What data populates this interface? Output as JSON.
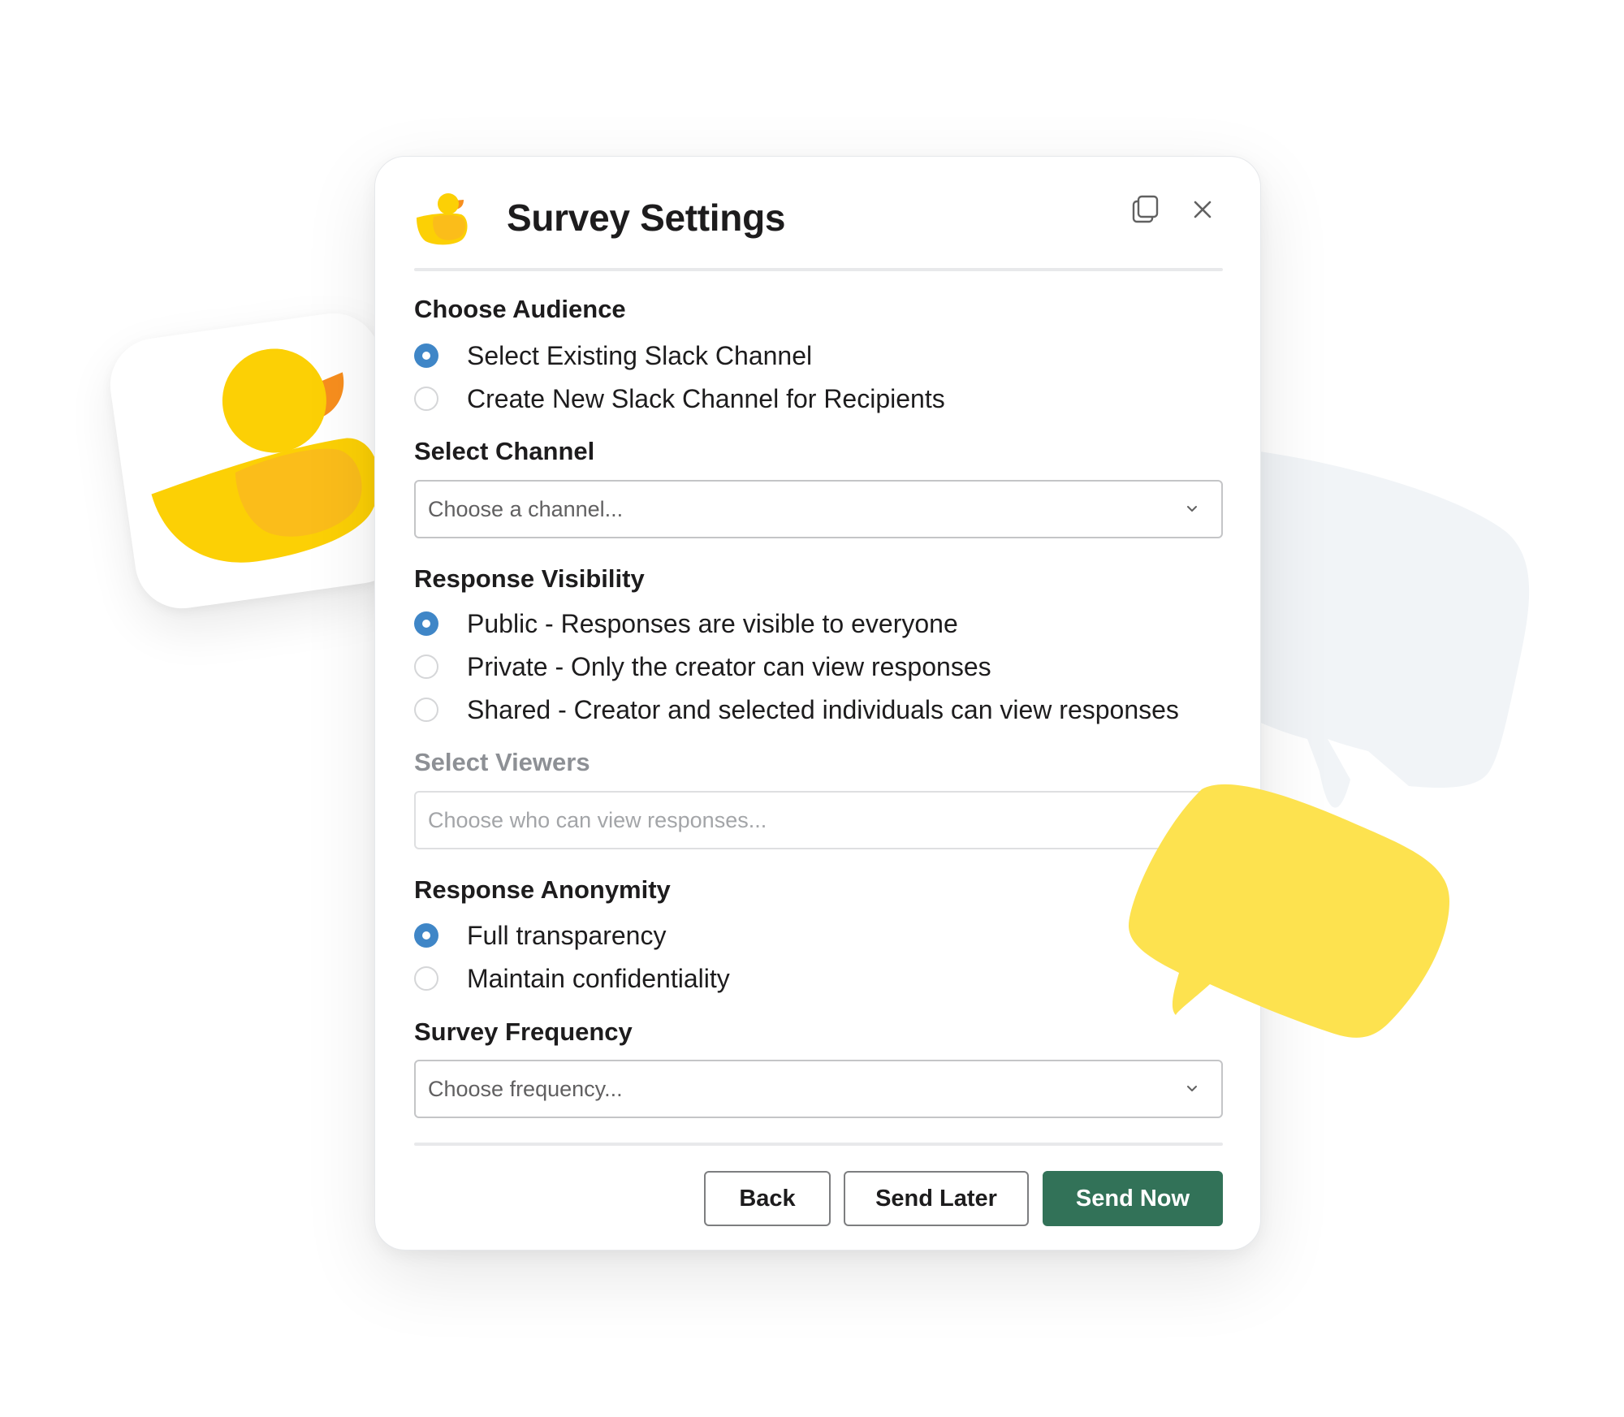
{
  "colors": {
    "primary_button": "#327258",
    "radio_selected": "#3f86c7",
    "duck_yellow": "#fcd005",
    "duck_beak": "#f78e1e",
    "bubble_yellow": "#fde24f",
    "bubble_gray": "#f1f4f7"
  },
  "icons": {
    "app_logo": "duck-icon",
    "window": "copy-icon",
    "close": "close-icon",
    "select_chevron": "chevron-down-icon"
  },
  "modal": {
    "title": "Survey Settings",
    "audience": {
      "label": "Choose Audience",
      "options": [
        {
          "label": "Select Existing Slack Channel",
          "selected": true
        },
        {
          "label": "Create New Slack Channel for Recipients",
          "selected": false
        }
      ]
    },
    "channel": {
      "label": "Select Channel",
      "placeholder": "Choose a channel..."
    },
    "visibility": {
      "label": "Response Visibility",
      "options": [
        {
          "label": "Public - Responses are visible to everyone",
          "selected": true
        },
        {
          "label": "Private - Only the creator can view responses",
          "selected": false
        },
        {
          "label": "Shared - Creator and selected individuals can view responses",
          "selected": false
        }
      ]
    },
    "viewers": {
      "label": "Select Viewers",
      "placeholder": "Choose who can view responses...",
      "disabled": true
    },
    "anonymity": {
      "label": "Response Anonymity",
      "options": [
        {
          "label": "Full transparency",
          "selected": true
        },
        {
          "label": "Maintain confidentiality",
          "selected": false
        }
      ]
    },
    "frequency": {
      "label": "Survey Frequency",
      "placeholder": "Choose frequency..."
    },
    "buttons": {
      "back": "Back",
      "send_later": "Send Later",
      "send_now": "Send Now"
    }
  }
}
